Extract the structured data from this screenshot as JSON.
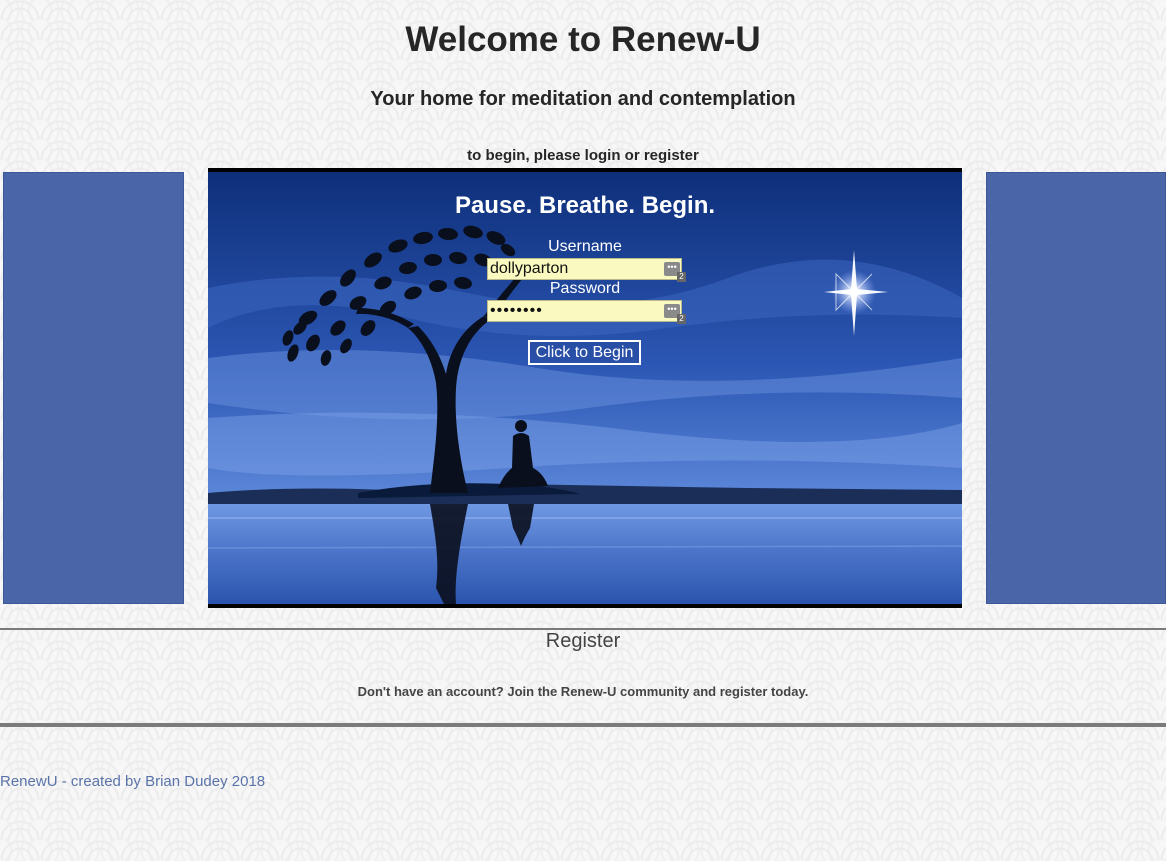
{
  "header": {
    "title": "Welcome to Renew-U",
    "subtitle": "Your home for meditation and contemplation",
    "prompt": "to begin, please login or register"
  },
  "login": {
    "tagline": "Pause. Breathe. Begin.",
    "username_label": "Username",
    "username_value": "dollyparton",
    "password_label": "Password",
    "password_value": "••••••••",
    "submit_label": "Click to Begin",
    "autofill_badge": "2"
  },
  "register": {
    "heading": "Register",
    "text": "Don't have an account? Join the Renew-U community and register today."
  },
  "footer": {
    "credit": "RenewU - created by Brian Dudey 2018"
  },
  "colors": {
    "side_panel": "#4b66a8",
    "sky_top": "#0e2f7a",
    "sky_bottom": "#5b86d8",
    "input_bg": "#fafac0",
    "footer_link": "#5a74aa"
  },
  "icons": {
    "autofill": "key-icon",
    "star": "star-icon"
  }
}
